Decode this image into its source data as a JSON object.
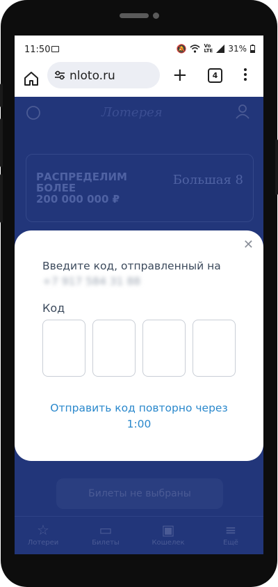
{
  "statusbar": {
    "time": "11:50",
    "battery": "31%",
    "icons": [
      "image-icon",
      "mute-icon",
      "wifi-icon",
      "volte-icon",
      "signal-icon",
      "battery-icon"
    ]
  },
  "browser": {
    "url": "nloto.ru",
    "tab_count": "4"
  },
  "page": {
    "banner_lines": [
      "РАСПРЕДЕЛИМ",
      "БОЛЕЕ",
      "200 000 000 ₽"
    ],
    "banner_game": "Большая 8",
    "tickets_button": "Билеты не выбраны",
    "nav": [
      {
        "label": "Лотереи",
        "icon": "star-icon"
      },
      {
        "label": "Билеты",
        "icon": "ticket-icon"
      },
      {
        "label": "Кошелек",
        "icon": "wallet-icon"
      },
      {
        "label": "Ещё",
        "icon": "menu-icon"
      }
    ]
  },
  "modal": {
    "prompt": "Введите код, отправленный на",
    "phone": "+7 917 584 31 88",
    "code_label": "Код",
    "code_values": [
      "",
      "",
      "",
      ""
    ],
    "resend_line1": "Отправить код повторно через",
    "resend_timer": "1:00",
    "accent_color": "#2a88cc"
  }
}
